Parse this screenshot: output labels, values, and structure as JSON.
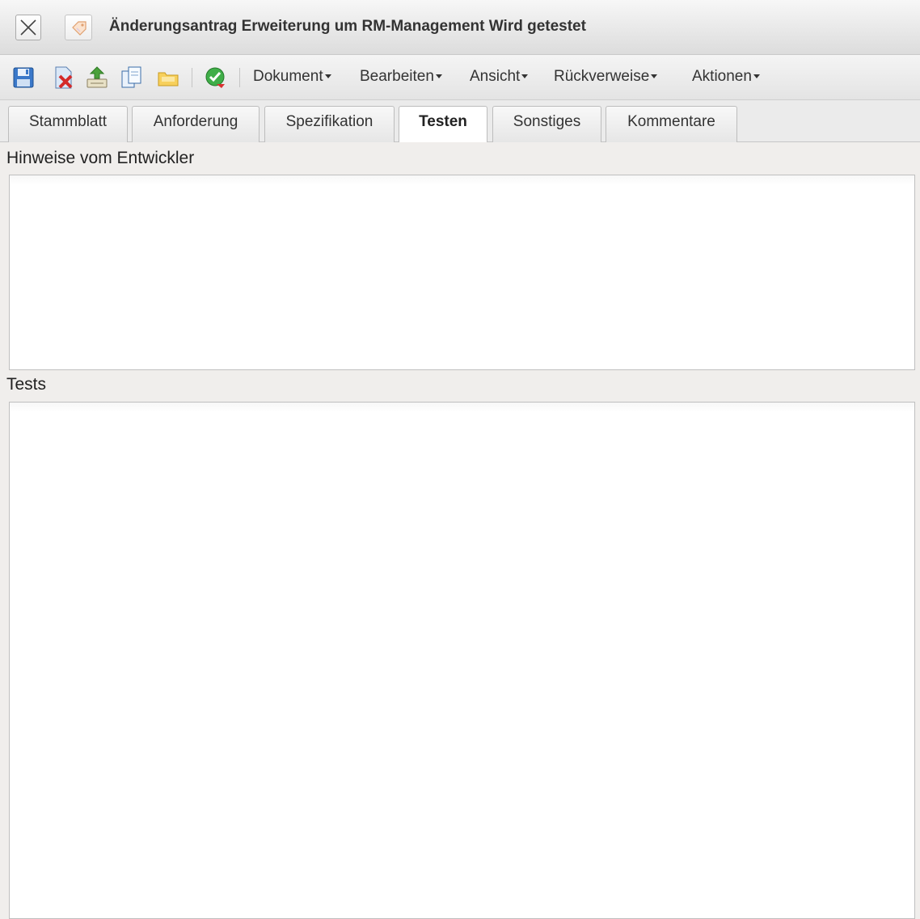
{
  "window": {
    "title": "Änderungsantrag Erweiterung um RM-Management Wird getestet"
  },
  "toolbar": {
    "icons": [
      "save-icon",
      "delete-document-icon",
      "upload-icon",
      "copy-icon",
      "folder-icon",
      "check-icon"
    ],
    "menus": [
      {
        "label": "Dokument"
      },
      {
        "label": "Bearbeiten"
      },
      {
        "label": "Ansicht"
      },
      {
        "label": "Rückverweise"
      },
      {
        "label": "Aktionen"
      }
    ]
  },
  "tabs": [
    {
      "label": "Stammblatt",
      "active": false
    },
    {
      "label": "Anforderung",
      "active": false
    },
    {
      "label": "Spezifikation",
      "active": false
    },
    {
      "label": "Testen",
      "active": true
    },
    {
      "label": "Sonstiges",
      "active": false
    },
    {
      "label": "Kommentare",
      "active": false
    }
  ],
  "sections": {
    "developer_notes": {
      "label": "Hinweise vom Entwickler",
      "value": ""
    },
    "tests": {
      "label": "Tests",
      "value": ""
    }
  }
}
